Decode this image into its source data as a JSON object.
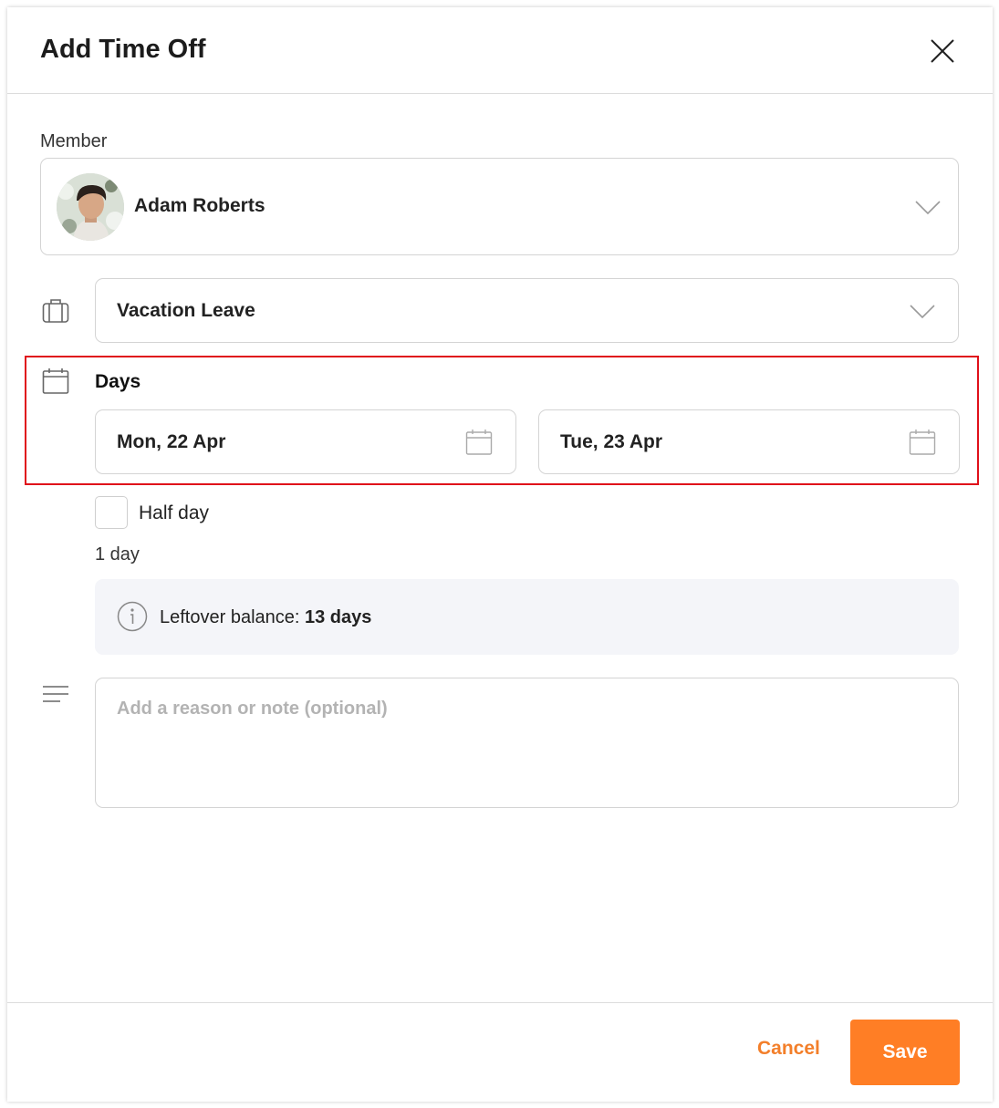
{
  "dialog": {
    "title": "Add Time Off",
    "close_icon": "close-icon"
  },
  "member": {
    "label": "Member",
    "name": "Adam Roberts",
    "avatar_icon": "avatar"
  },
  "leave_type": {
    "icon": "briefcase-icon",
    "value": "Vacation Leave"
  },
  "days": {
    "icon": "calendar-icon",
    "label": "Days",
    "start": "Mon, 22 Apr",
    "end": "Tue, 23 Apr"
  },
  "half_day": {
    "label": "Half day",
    "checked": false
  },
  "duration": "1 day",
  "balance": {
    "label": "Leftover balance:",
    "value": "13 days",
    "icon": "info-icon"
  },
  "note": {
    "icon": "notes-icon",
    "placeholder": "Add a reason or note (optional)",
    "value": ""
  },
  "actions": {
    "cancel_label": "Cancel",
    "save_label": "Save"
  },
  "colors": {
    "accent": "#ff7e25",
    "highlight": "#e0101a",
    "info_bg": "#f4f5f9"
  }
}
